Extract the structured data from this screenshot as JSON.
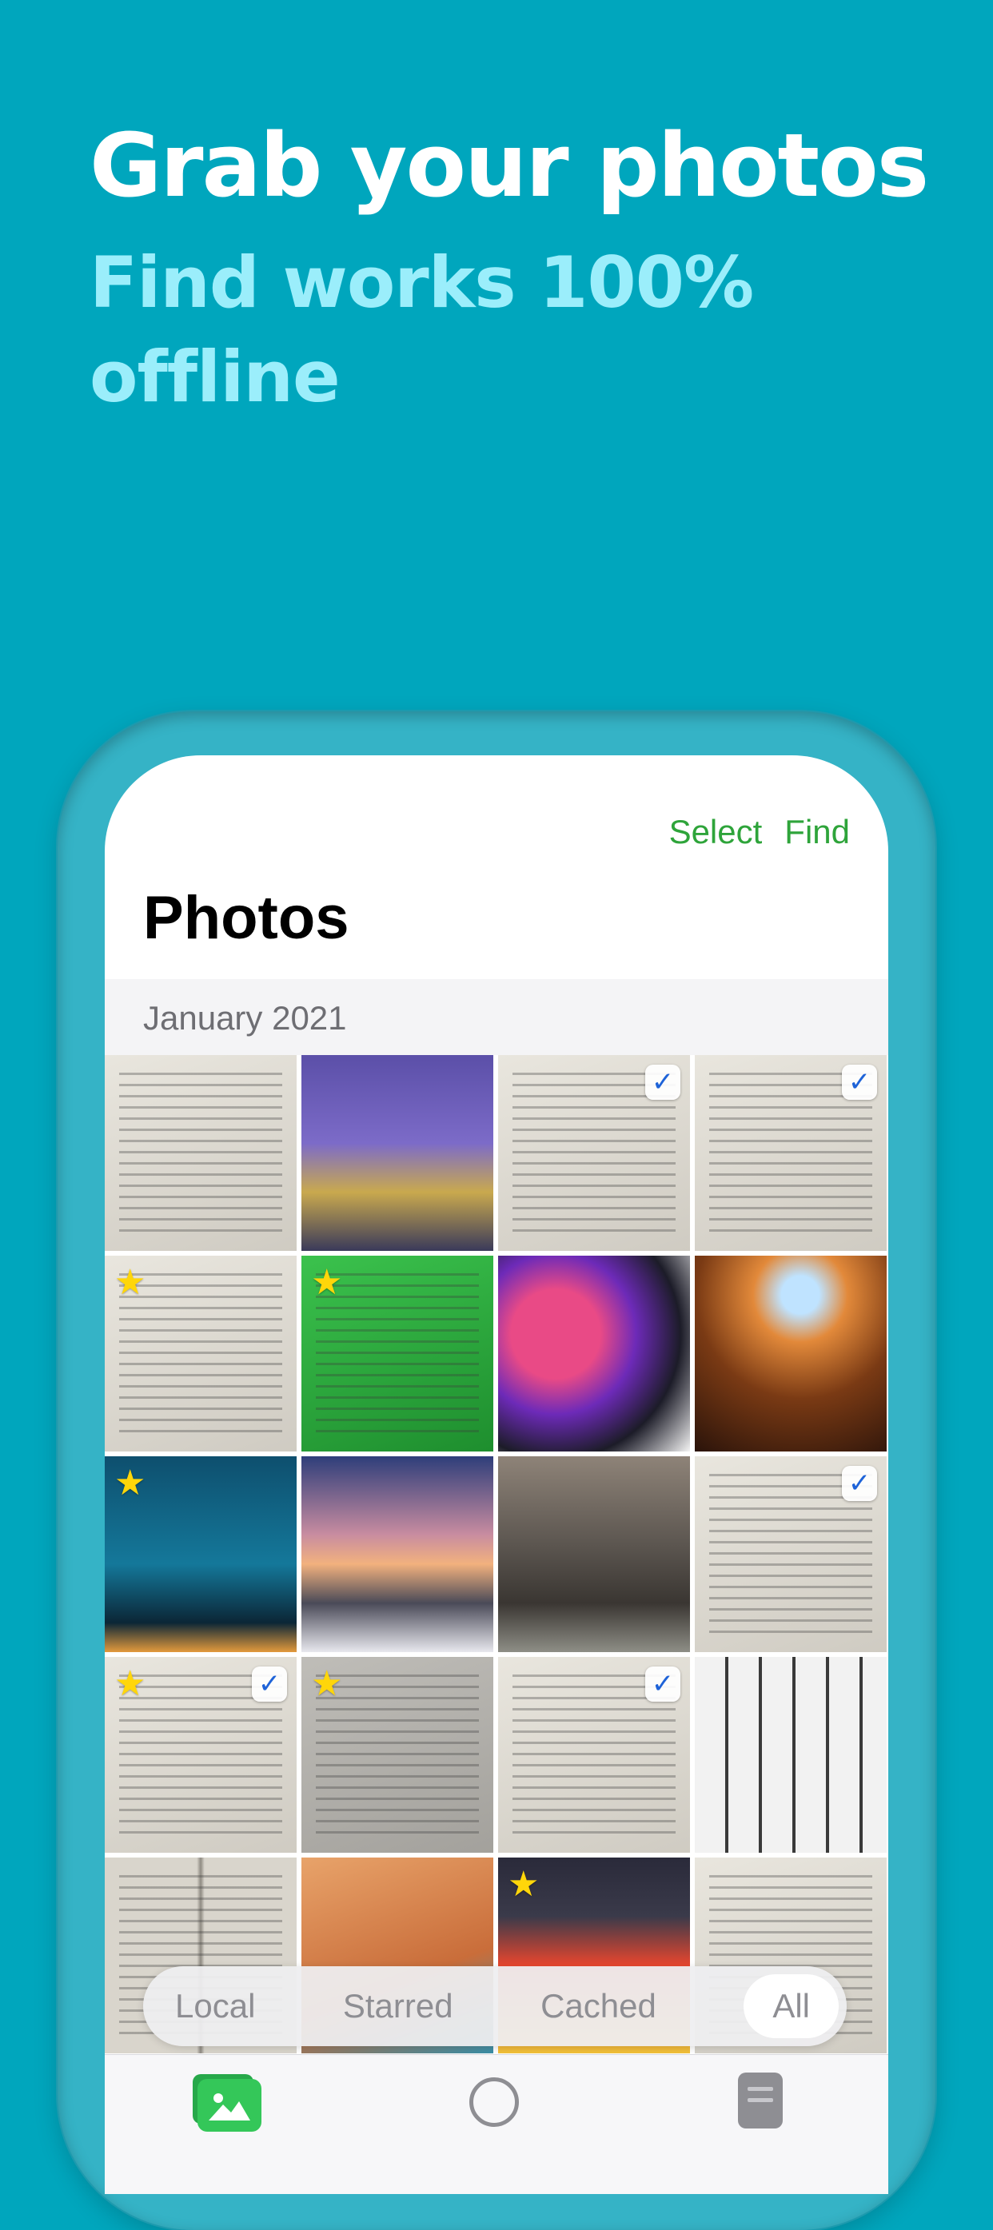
{
  "headline": "Grab your photos",
  "subhead": "Find works 100% offline",
  "screen": {
    "actions": {
      "select": "Select",
      "find": "Find"
    },
    "title": "Photos",
    "section": "January 2021",
    "photos": [
      {
        "kind": "document",
        "starred": false,
        "cached": false
      },
      {
        "kind": "book-cover-avancemos",
        "starred": false,
        "cached": false
      },
      {
        "kind": "document",
        "starred": false,
        "cached": true
      },
      {
        "kind": "document",
        "starred": false,
        "cached": true
      },
      {
        "kind": "document",
        "starred": true,
        "cached": false
      },
      {
        "kind": "green-screen",
        "starred": true,
        "cached": false
      },
      {
        "kind": "abstract-wallpaper",
        "starred": false,
        "cached": false
      },
      {
        "kind": "canyon",
        "starred": false,
        "cached": false
      },
      {
        "kind": "night-sky",
        "starred": true,
        "cached": false
      },
      {
        "kind": "mountain-sunset",
        "starred": false,
        "cached": false
      },
      {
        "kind": "hills",
        "starred": false,
        "cached": false
      },
      {
        "kind": "document",
        "starred": false,
        "cached": true
      },
      {
        "kind": "document",
        "starred": true,
        "cached": true
      },
      {
        "kind": "graph-worksheet",
        "starred": true,
        "cached": false
      },
      {
        "kind": "document",
        "starred": false,
        "cached": true
      },
      {
        "kind": "comic",
        "starred": false,
        "cached": false
      },
      {
        "kind": "open-book",
        "starred": false,
        "cached": false
      },
      {
        "kind": "poster",
        "starred": false,
        "cached": false
      },
      {
        "kind": "book-cover-house",
        "starred": true,
        "cached": false
      },
      {
        "kind": "document",
        "starred": false,
        "cached": false
      }
    ],
    "filters": [
      "Local",
      "Starred",
      "Cached",
      "All"
    ],
    "active_filter": "All",
    "tabs": [
      {
        "icon": "photos-icon",
        "active": true
      },
      {
        "icon": "camera-icon",
        "active": false
      },
      {
        "icon": "lists-icon",
        "active": false
      }
    ]
  },
  "colors": {
    "background": "#00A6BD",
    "subhead": "#9BEEFB",
    "accent_green": "#2EA43A",
    "star": "#FFD60A",
    "check": "#1E63D8"
  }
}
